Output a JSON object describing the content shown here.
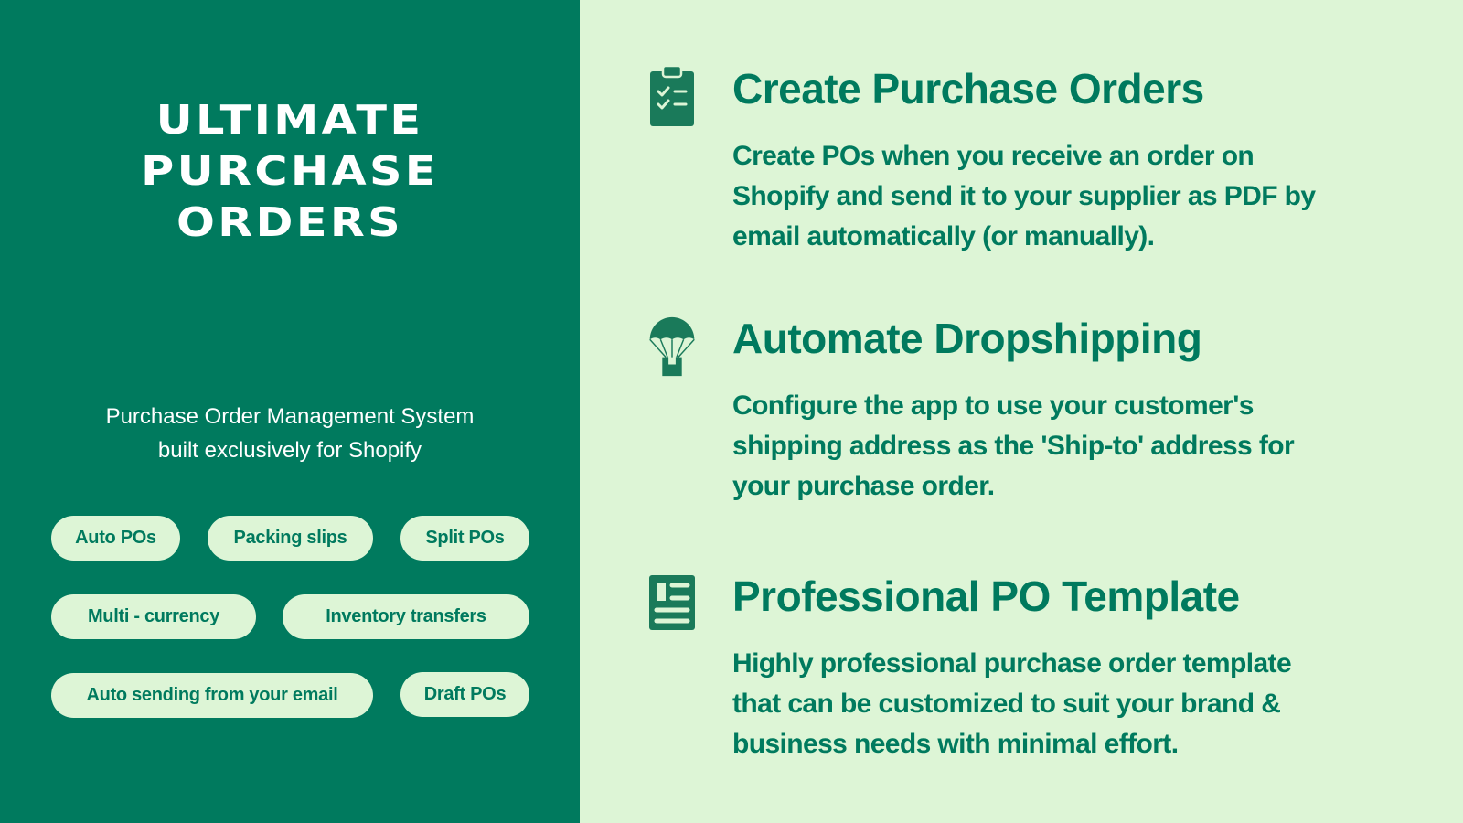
{
  "colors": {
    "primary": "#007A5E",
    "light": "#DDF5D6",
    "white": "#FFFFFF"
  },
  "left_panel": {
    "title_lines": [
      "ULTIMATE",
      "PURCHASE",
      "ORDERS"
    ],
    "subtitle_lines": [
      "Purchase Order Management System",
      "built exclusively for Shopify"
    ],
    "tags": [
      "Auto POs",
      "Packing slips",
      "Split POs",
      "Multi - currency",
      "Inventory transfers",
      "Auto sending from your email",
      "Draft POs"
    ]
  },
  "features": [
    {
      "icon": "clipboard-check-icon",
      "title": "Create Purchase Orders",
      "description_lines": [
        "Create POs when you receive an order on",
        "Shopify and send it to your supplier as PDF by",
        "email automatically (or manually)."
      ]
    },
    {
      "icon": "parachute-icon",
      "title": "Automate Dropshipping",
      "description_lines": [
        "Configure the app to use your customer's",
        "shipping address as the 'Ship-to' address for",
        "your purchase order."
      ]
    },
    {
      "icon": "document-template-icon",
      "title": "Professional PO Template",
      "description_lines": [
        "Highly professional purchase order template",
        "that can be customized to suit your brand &",
        "business needs with minimal effort."
      ]
    }
  ]
}
